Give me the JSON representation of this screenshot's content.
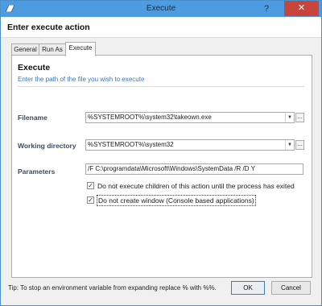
{
  "window": {
    "title": "Execute",
    "help": "?",
    "close": "✕"
  },
  "dialog": {
    "heading": "Enter execute action"
  },
  "tabs": [
    {
      "label": "General"
    },
    {
      "label": "Run As"
    },
    {
      "label": "Execute"
    }
  ],
  "section": {
    "title": "Execute",
    "description": "Enter the path of the file you wish to execute"
  },
  "fields": {
    "filename": {
      "label": "Filename",
      "value": "%SYSTEMROOT%\\system32\\takeown.exe"
    },
    "working_directory": {
      "label": "Working directory",
      "value": "%SYSTEMROOT%\\system32"
    },
    "parameters": {
      "label": "Parameters",
      "value": "/F C:\\programdata\\Microsoft\\Windows\\SystemData /R /D Y"
    }
  },
  "browse_label": "...",
  "checkboxes": [
    {
      "label": "Do not execute children of this action until the process has exited",
      "checked": true
    },
    {
      "label": "Do not create window (Console based applications)",
      "checked": true
    }
  ],
  "check_mark": "✓",
  "dropdown_glyph": "▼",
  "tip": "Tip: To stop an environment variable from expanding replace % with %%.",
  "buttons": {
    "ok": "OK",
    "cancel": "Cancel"
  }
}
